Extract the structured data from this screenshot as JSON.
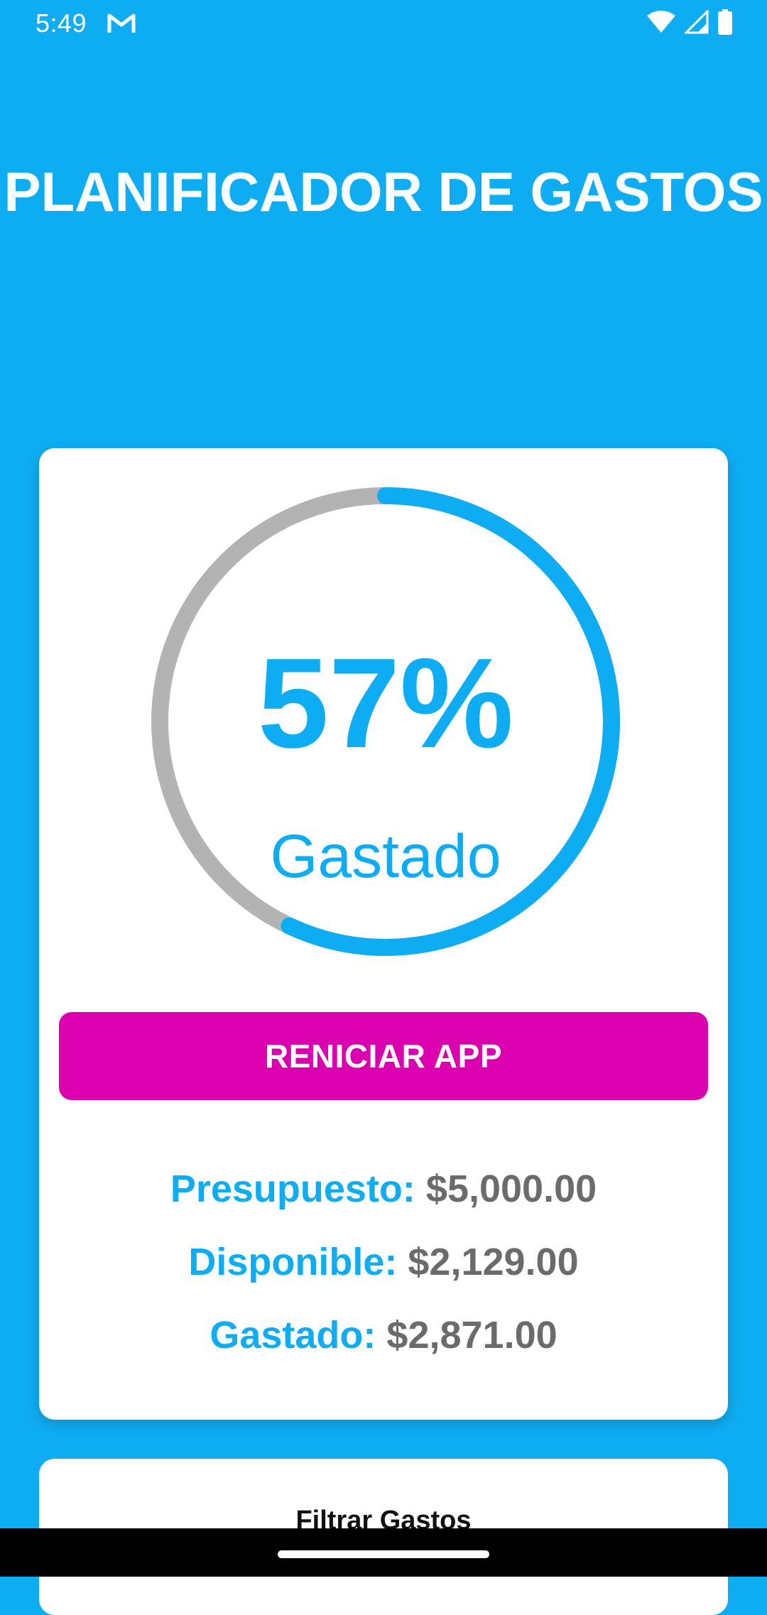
{
  "status_bar": {
    "time": "5:49",
    "icons": [
      "gmail-icon",
      "wifi-icon",
      "signal-icon",
      "battery-icon"
    ]
  },
  "app": {
    "title": "PLANIFICADOR DE GASTOS"
  },
  "progress": {
    "percent": 57,
    "percent_text": "57%",
    "label": "Gastado",
    "track_color": "#B3B3B3",
    "fill_color": "#0EADF3"
  },
  "actions": {
    "reset_label": "RENICIAR APP"
  },
  "summary": {
    "presupuesto_label": "Presupuesto:",
    "presupuesto_value": "$5,000.00",
    "disponible_label": "Disponible:",
    "disponible_value": "$2,129.00",
    "gastado_label": "Gastado:",
    "gastado_value": "$2,871.00"
  },
  "filter": {
    "title": "Filtrar Gastos"
  },
  "colors": {
    "background": "#0EADF3",
    "accent": "#0EADF3",
    "button": "#DB00AE",
    "value_text": "#6B6B6B"
  }
}
